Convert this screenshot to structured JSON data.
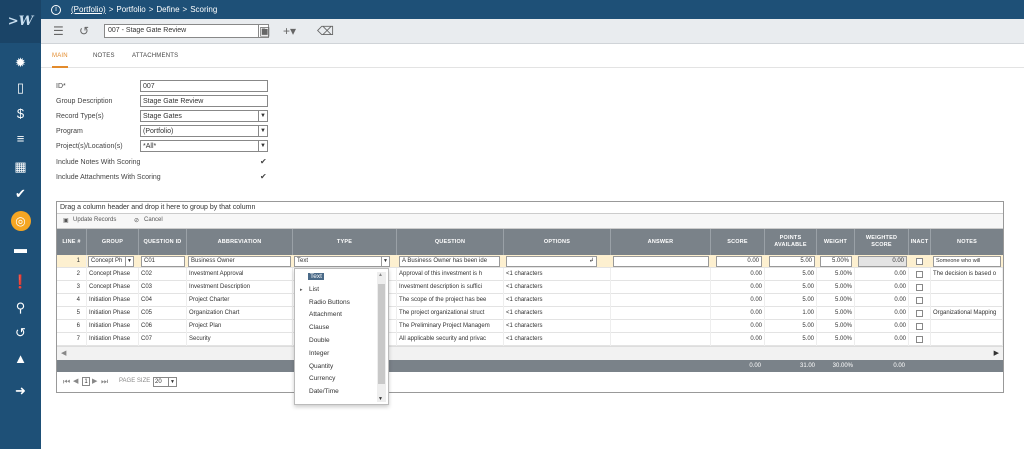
{
  "app": {
    "logo": ">W"
  },
  "breadcrumb": {
    "root": "(Portfolio)",
    "sep1": ">",
    "p1": "Portfolio",
    "sep2": ">",
    "p2": "Define",
    "sep3": ">",
    "p3": "Scoring"
  },
  "toolbar": {
    "record": "007 - Stage Gate Review"
  },
  "tabs": [
    {
      "label": "MAIN"
    },
    {
      "label": "NOTES"
    },
    {
      "label": "ATTACHMENTS"
    }
  ],
  "form": {
    "id_label": "ID*",
    "id_value": "007",
    "desc_label": "Group Description",
    "desc_value": "Stage Gate Review",
    "rectype_label": "Record Type(s)",
    "rectype_value": "Stage Gates",
    "program_label": "Program",
    "program_value": "(Portfolio)",
    "projects_label": "Project(s)/Location(s)",
    "projects_value": "*All*",
    "notes_label": "Include Notes With Scoring",
    "attach_label": "Include Attachments With Scoring"
  },
  "grid": {
    "group_panel": "Drag a column header and drop it here to group by that column",
    "update": "Update Records",
    "cancel": "Cancel",
    "headers": {
      "line": "LINE #",
      "group": "GROUP",
      "question_id": "QUESTION ID",
      "abbreviation": "ABBREVIATION",
      "type": "TYPE",
      "question": "QUESTION",
      "options": "OPTIONS",
      "answer": "ANSWER",
      "score": "SCORE",
      "points": "POINTS AVAILABLE",
      "weight": "WEIGHT",
      "weighted": "WEIGHTED SCORE",
      "inactive": "INACT",
      "notes": "NOTES"
    },
    "edit_row": {
      "line": "1",
      "group": "Concept Ph",
      "question_id": "C01",
      "abbreviation": "Business Owner",
      "type": "Text",
      "question": "A Business Owner has been ide",
      "options": "",
      "answer": "",
      "score": "0.00",
      "points": "5.00",
      "weight": "5.00%",
      "weighted": "0.00",
      "notes": "Someone who will"
    },
    "rows": [
      {
        "line": "2",
        "group": "Concept Phase",
        "qid": "C02",
        "abbr": "Investment Approval",
        "question": "Approval of this investment is h",
        "options": "<1 characters",
        "score": "0.00",
        "points": "5.00",
        "weight": "5.00%",
        "weighted": "0.00",
        "notes": "The decision is based o"
      },
      {
        "line": "3",
        "group": "Concept Phase",
        "qid": "C03",
        "abbr": "Investment Description",
        "question": "Investment description is suffici",
        "options": "<1 characters",
        "score": "0.00",
        "points": "5.00",
        "weight": "5.00%",
        "weighted": "0.00",
        "notes": ""
      },
      {
        "line": "4",
        "group": "Initiation Phase",
        "qid": "C04",
        "abbr": "Project Charter",
        "question": "The scope of the project has bee",
        "options": "<1 characters",
        "score": "0.00",
        "points": "5.00",
        "weight": "5.00%",
        "weighted": "0.00",
        "notes": ""
      },
      {
        "line": "5",
        "group": "Initiation Phase",
        "qid": "C05",
        "abbr": "Organization Chart",
        "question": "The project organizational struct",
        "options": "<1 characters",
        "score": "0.00",
        "points": "1.00",
        "weight": "5.00%",
        "weighted": "0.00",
        "notes": "Organizational Mapping"
      },
      {
        "line": "6",
        "group": "Initiation Phase",
        "qid": "C06",
        "abbr": "Project Plan",
        "question": "The Preliminary Project Managem",
        "options": "<1 characters",
        "score": "0.00",
        "points": "5.00",
        "weight": "5.00%",
        "weighted": "0.00",
        "notes": ""
      },
      {
        "line": "7",
        "group": "Initiation Phase",
        "qid": "C07",
        "abbr": "Security",
        "question": "All applicable security and privac",
        "options": "<1 characters",
        "score": "0.00",
        "points": "5.00",
        "weight": "5.00%",
        "weighted": "0.00",
        "notes": ""
      }
    ],
    "footer": {
      "score": "0.00",
      "points": "31.00",
      "weight": "30.00%",
      "weighted": "0.00"
    },
    "pager": {
      "page": "1",
      "size_label": "PAGE SIZE",
      "size": "20"
    }
  },
  "dropdown": {
    "options": [
      "Text",
      "List",
      "Radio Buttons",
      "Attachment",
      "Clause",
      "Double",
      "Integer",
      "Quantity",
      "Currency",
      "Date/Time"
    ]
  }
}
